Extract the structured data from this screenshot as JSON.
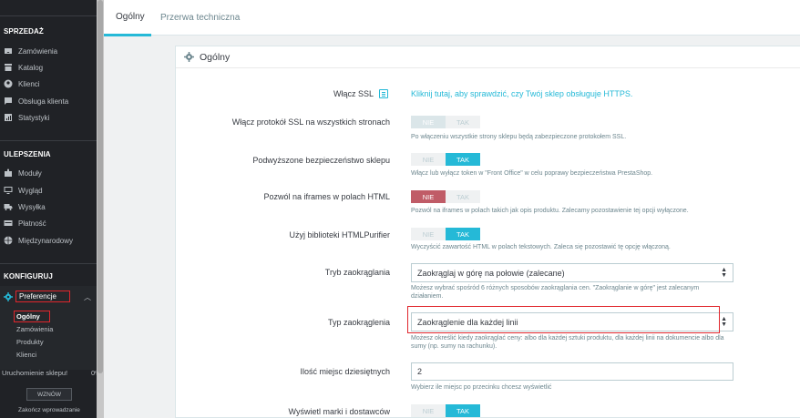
{
  "sidebar": {
    "sections": [
      {
        "title": "SPRZEDAŻ",
        "items": [
          {
            "label": "Zamówienia",
            "icon": "inbox-icon"
          },
          {
            "label": "Katalog",
            "icon": "store-icon"
          },
          {
            "label": "Klienci",
            "icon": "user-icon"
          },
          {
            "label": "Obsługa klienta",
            "icon": "chat-icon"
          },
          {
            "label": "Statystyki",
            "icon": "bar-chart-icon"
          }
        ]
      },
      {
        "title": "ULEPSZENIA",
        "items": [
          {
            "label": "Moduły",
            "icon": "puzzle-icon"
          },
          {
            "label": "Wygląd",
            "icon": "monitor-icon"
          },
          {
            "label": "Wysyłka",
            "icon": "truck-icon"
          },
          {
            "label": "Płatność",
            "icon": "credit-card-icon"
          },
          {
            "label": "Międzynarodowy",
            "icon": "globe-icon"
          }
        ]
      },
      {
        "title": "KONFIGURUJ",
        "items": []
      }
    ],
    "active_item": {
      "label": "Preferencje",
      "icon": "gear-icon"
    },
    "submenu": [
      "Ogólny",
      "Zamówienia",
      "Produkty",
      "Klienci"
    ],
    "start_label": "Uruchomienie sklepu!",
    "start_percent": "0%",
    "resume_button": "WZNÓW",
    "end_label": "Zakończ wprowadzanie"
  },
  "tabs": [
    "Ogólny",
    "Przerwa techniczna"
  ],
  "panel": {
    "title": "Ogólny",
    "ssl": {
      "label": "Włącz SSL",
      "link": "Kliknij tutaj, aby sprawdzić, czy Twój sklep obsługuje HTTPS."
    },
    "switch_labels": {
      "no": "NIE",
      "yes": "TAK"
    },
    "fields": [
      {
        "label": "Włącz protokół SSL na wszystkich stronach",
        "help": "Po włączeniu wszystkie strony sklepu będą zabezpieczone protokołem SSL."
      },
      {
        "label": "Podwyższone bezpieczeństwo sklepu",
        "help": "Włącz lub wyłącz token w \"Front Office\" w celu poprawy bezpieczeństwa PrestaShop."
      },
      {
        "label": "Pozwól na iframes w polach HTML",
        "help": "Pozwól na iframes w polach takich jak opis produktu. Zalecamy pozostawienie tej opcji wyłączone."
      },
      {
        "label": "Użyj biblioteki HTMLPurifier",
        "help": "Wyczyścić zawartość HTML w polach tekstowych. Zaleca się pozostawić tę opcję włączoną."
      },
      {
        "label": "Tryb zaokrąglania",
        "value": "Zaokrąglaj w górę na połowie (zalecane)",
        "help": "Możesz wybrać spośród 6 różnych sposobów zaokrąglania cen. \"Zaokrąglanie w górę\" jest zalecanym działaniem."
      },
      {
        "label": "Typ zaokrąglenia",
        "value": "Zaokrąglenie dla każdej linii",
        "help": "Możesz określić kiedy zaokrąglać ceny: albo dla każdej sztuki produktu, dla każdej linii na dokumencie albo dla sumy (np. sumy na rachunku)."
      },
      {
        "label": "Ilość miejsc dziesiętnych",
        "value": "2",
        "help": "Wybierz ile miejsc po przecinku chcesz wyświetlić"
      },
      {
        "label": "Wyświetl marki i dostawców"
      }
    ]
  },
  "colors": {
    "accent": "#25b9d7",
    "danger": "#c05c67",
    "sidebar_bg": "#202226",
    "highlight": "#e0262c"
  }
}
